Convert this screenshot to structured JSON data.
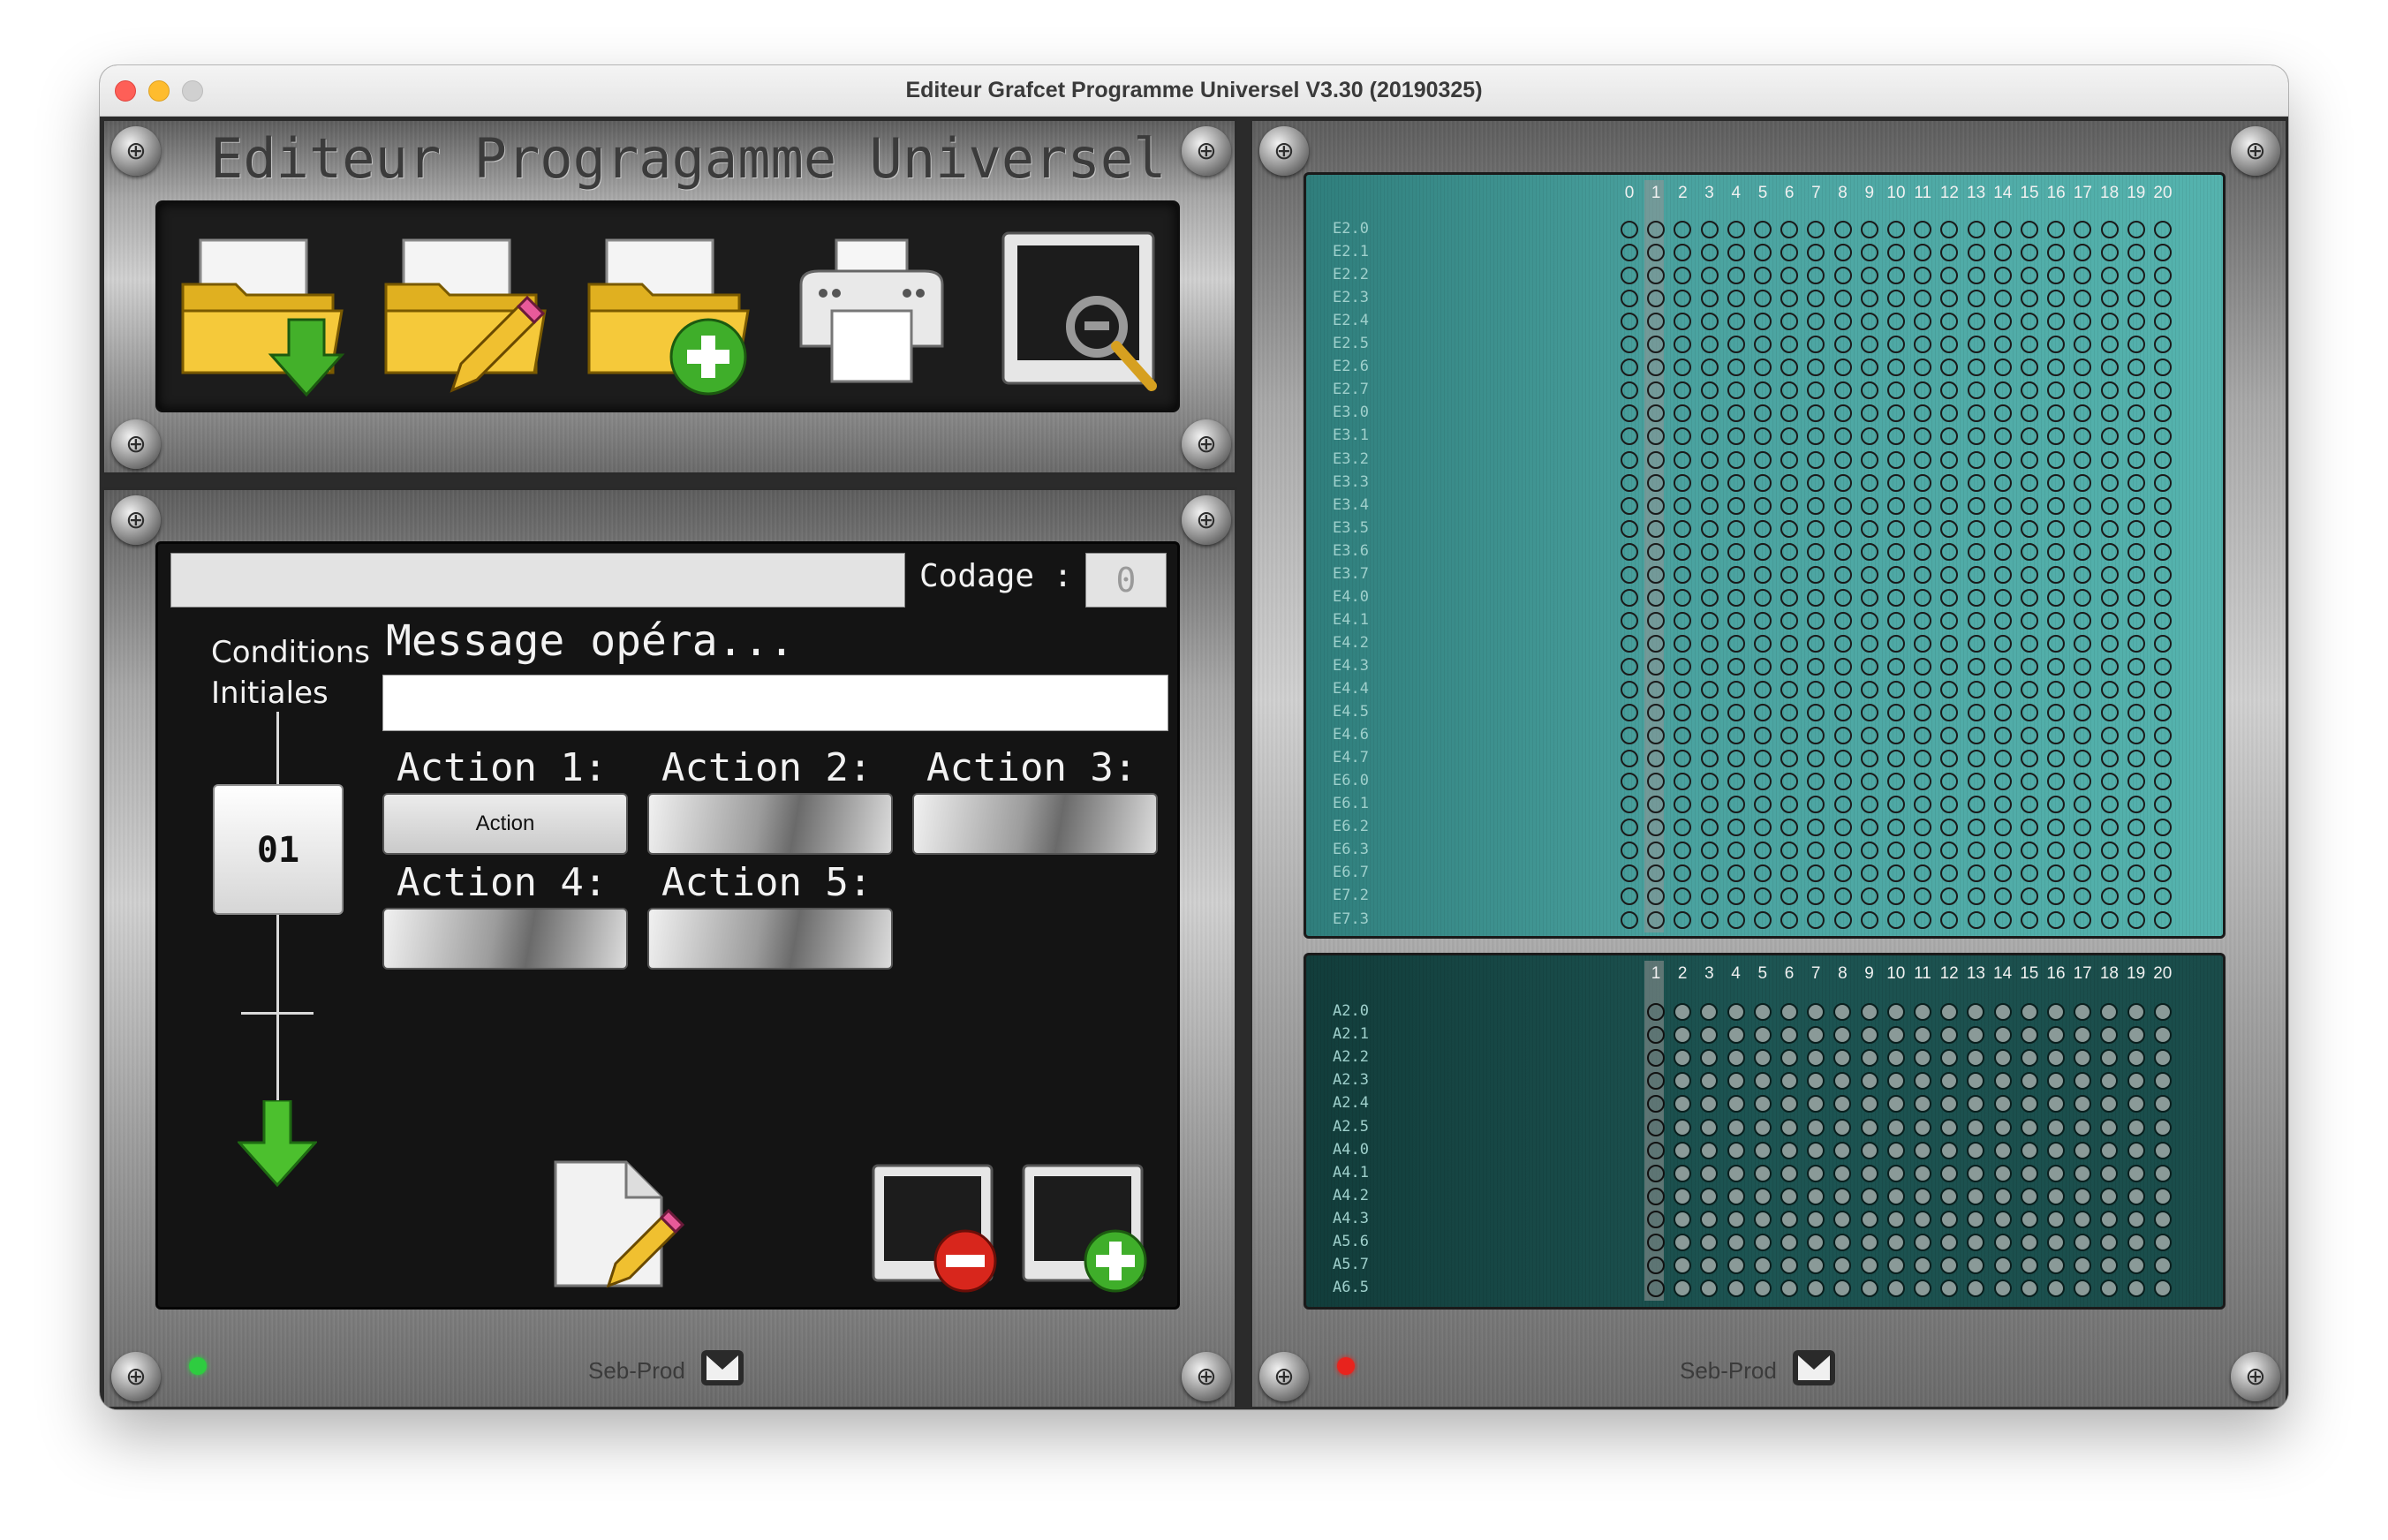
{
  "window": {
    "title": "Editeur Grafcet Programme Universel V3.30 (20190325)"
  },
  "header": {
    "app_title": "Editeur Progragamme Universel"
  },
  "toolbar": {
    "tools": [
      {
        "name": "open-file",
        "icon": "folder-download-icon"
      },
      {
        "name": "edit-file",
        "icon": "folder-pencil-icon"
      },
      {
        "name": "new-file",
        "icon": "folder-plus-icon"
      },
      {
        "name": "print",
        "icon": "printer-icon"
      },
      {
        "name": "view",
        "icon": "monitor-magnifier-icon"
      }
    ]
  },
  "editor": {
    "name_value": "",
    "codage_label": "Codage :",
    "codage_value": "0",
    "conditions_label_line1": "Conditions",
    "conditions_label_line2": "Initiales",
    "message_label": "Message opéra...",
    "message_value": "",
    "step_number": "01",
    "actions": [
      {
        "label": "Action 1:",
        "value": "Action"
      },
      {
        "label": "Action 2:",
        "value": ""
      },
      {
        "label": "Action 3:",
        "value": ""
      },
      {
        "label": "Action 4:",
        "value": ""
      },
      {
        "label": "Action 5:",
        "value": ""
      }
    ],
    "brand": "Seb-Prod",
    "led_color": "#2ecc40"
  },
  "inputs_grid": {
    "columns": [
      "0",
      "1",
      "2",
      "3",
      "4",
      "5",
      "6",
      "7",
      "8",
      "9",
      "10",
      "11",
      "12",
      "13",
      "14",
      "15",
      "16",
      "17",
      "18",
      "19",
      "20"
    ],
    "highlighted_column": "1",
    "rows": [
      "E2.0",
      "E2.1",
      "E2.2",
      "E2.3",
      "E2.4",
      "E2.5",
      "E2.6",
      "E2.7",
      "E3.0",
      "E3.1",
      "E3.2",
      "E3.3",
      "E3.4",
      "E3.5",
      "E3.6",
      "E3.7",
      "E4.0",
      "E4.1",
      "E4.2",
      "E4.3",
      "E4.4",
      "E4.5",
      "E4.6",
      "E4.7",
      "E6.0",
      "E6.1",
      "E6.2",
      "E6.3",
      "E6.7",
      "E7.2",
      "E7.3"
    ]
  },
  "outputs_grid": {
    "columns": [
      "1",
      "2",
      "3",
      "4",
      "5",
      "6",
      "7",
      "8",
      "9",
      "10",
      "11",
      "12",
      "13",
      "14",
      "15",
      "16",
      "17",
      "18",
      "19",
      "20"
    ],
    "highlighted_column": "1",
    "rows": [
      "A2.0",
      "A2.1",
      "A2.2",
      "A2.3",
      "A2.4",
      "A2.5",
      "A4.0",
      "A4.1",
      "A4.2",
      "A4.3",
      "A5.6",
      "A5.7",
      "A6.5"
    ]
  },
  "right_footer": {
    "brand": "Seb-Prod",
    "led_color": "#e8231d"
  }
}
